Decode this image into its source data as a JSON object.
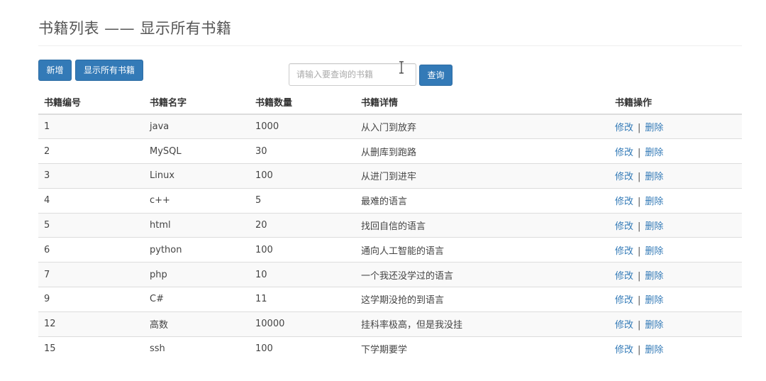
{
  "header": {
    "title": "书籍列表 —— 显示所有书籍"
  },
  "toolbar": {
    "add_label": "新增",
    "show_all_label": "显示所有书籍",
    "search_placeholder": "请输入要查询的书籍",
    "search_value": "",
    "query_label": "查询"
  },
  "colors": {
    "primary": "#337ab7",
    "stripe": "#f9f9f9",
    "border": "#dddddd"
  },
  "table": {
    "headers": {
      "id": "书籍编号",
      "name": "书籍名字",
      "count": "书籍数量",
      "detail": "书籍详情",
      "ops": "书籍操作"
    },
    "edit_label": "修改",
    "separator": "|",
    "delete_label": "删除",
    "rows": [
      {
        "id": "1",
        "name": "java",
        "count": "1000",
        "detail": "从入门到放弃"
      },
      {
        "id": "2",
        "name": "MySQL",
        "count": "30",
        "detail": "从删库到跑路"
      },
      {
        "id": "3",
        "name": "Linux",
        "count": "100",
        "detail": "从进门到进牢"
      },
      {
        "id": "4",
        "name": "c++",
        "count": "5",
        "detail": "最难的语言"
      },
      {
        "id": "5",
        "name": "html",
        "count": "20",
        "detail": "找回自信的语言"
      },
      {
        "id": "6",
        "name": "python",
        "count": "100",
        "detail": "通向人工智能的语言"
      },
      {
        "id": "7",
        "name": "php",
        "count": "10",
        "detail": "一个我还没学过的语言"
      },
      {
        "id": "9",
        "name": "C#",
        "count": "11",
        "detail": "这学期没抢的到语言"
      },
      {
        "id": "12",
        "name": "高数",
        "count": "10000",
        "detail": "挂科率极高，但是我没挂"
      },
      {
        "id": "15",
        "name": "ssh",
        "count": "100",
        "detail": "下学期要学"
      }
    ]
  }
}
